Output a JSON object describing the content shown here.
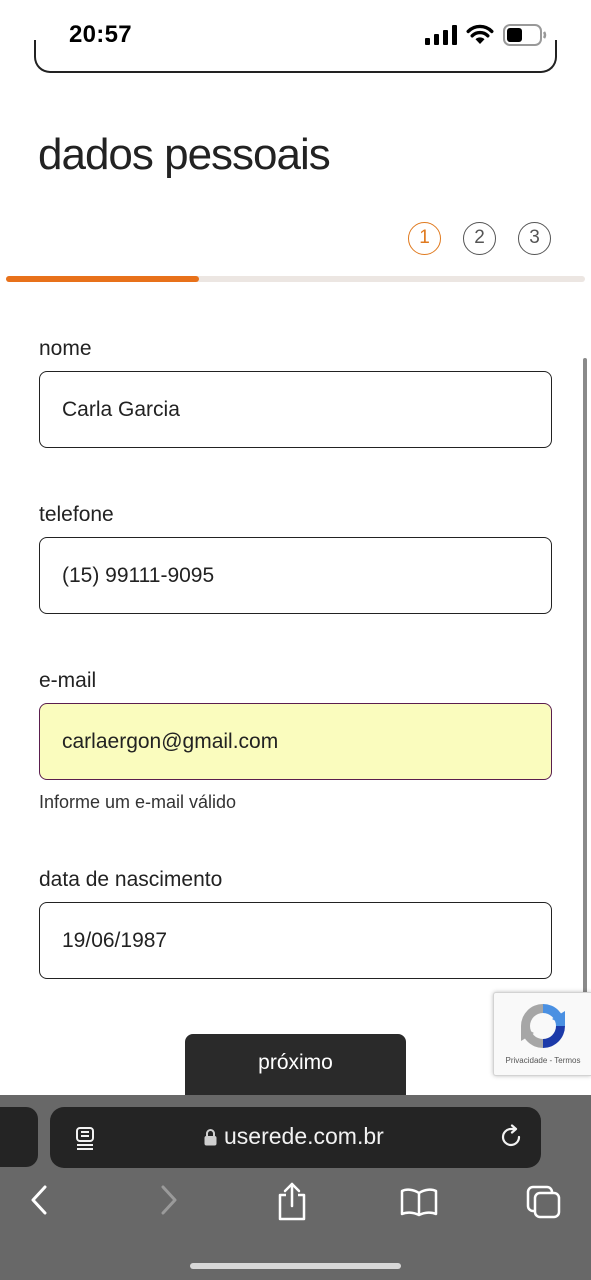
{
  "status_bar": {
    "time": "20:57"
  },
  "page": {
    "title": "dados pessoais"
  },
  "steps": [
    "1",
    "2",
    "3"
  ],
  "progress": {
    "current_step": 1,
    "total_steps": 3,
    "fraction": 0.333
  },
  "form": {
    "nome": {
      "label": "nome",
      "value": "Carla Garcia"
    },
    "telefone": {
      "label": "telefone",
      "value": "(15) 99111-9095"
    },
    "email": {
      "label": "e-mail",
      "value": "carlaergon@gmail.com",
      "help": "Informe um e-mail válido"
    },
    "nascimento": {
      "label": "data de nascimento",
      "value": "19/06/1987"
    }
  },
  "buttons": {
    "next": "próximo"
  },
  "recaptcha": {
    "links": "Privacidade - Termos"
  },
  "browser": {
    "url": "userede.com.br"
  },
  "colors": {
    "accent": "#e8711a",
    "autofill": "#fafcbe",
    "button": "#2a2a2a"
  },
  "icons": [
    "signal-icon",
    "wifi-icon",
    "battery-icon",
    "reader-icon",
    "lock-icon",
    "reload-icon",
    "back-icon",
    "forward-icon",
    "share-icon",
    "bookmarks-icon",
    "tabs-icon"
  ]
}
